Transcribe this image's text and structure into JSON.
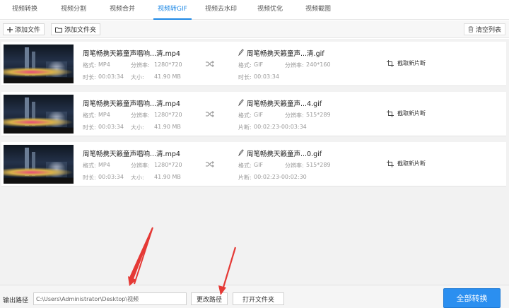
{
  "tabs": [
    {
      "label": "视频转换",
      "active": false
    },
    {
      "label": "视频分割",
      "active": false
    },
    {
      "label": "视频合并",
      "active": false
    },
    {
      "label": "视频转GIF",
      "active": true
    },
    {
      "label": "视频去水印",
      "active": false
    },
    {
      "label": "视频优化",
      "active": false
    },
    {
      "label": "视频截图",
      "active": false
    }
  ],
  "toolbar": {
    "add_file": "添加文件",
    "add_folder": "添加文件夹",
    "clear_list": "清空列表"
  },
  "labels": {
    "format": "格式:",
    "resolution": "分辨率:",
    "duration": "时长:",
    "size": "大小:",
    "segment": "片断:",
    "clip_new": "截取新片断"
  },
  "files": [
    {
      "src_name": "周笔畅携天籁童声唱响...清.mp4",
      "src_format": "MP4",
      "src_resolution": "1280*720",
      "src_duration": "00:03:34",
      "src_size": "41.90 MB",
      "out_name": "周笔畅携天籁童声...清.gif",
      "out_format": "GIF",
      "out_resolution": "240*160",
      "out_time_label": "时长:",
      "out_time": "00:03:34"
    },
    {
      "src_name": "周笔畅携天籁童声唱响...清.mp4",
      "src_format": "MP4",
      "src_resolution": "1280*720",
      "src_duration": "00:03:34",
      "src_size": "41.90 MB",
      "out_name": "周笔畅携天籁童声...4.gif",
      "out_format": "GIF",
      "out_resolution": "515*289",
      "out_time_label": "片断:",
      "out_time": "00:02:23-00:03:34"
    },
    {
      "src_name": "周笔畅携天籁童声唱响...清.mp4",
      "src_format": "MP4",
      "src_resolution": "1280*720",
      "src_duration": "00:03:34",
      "src_size": "41.90 MB",
      "out_name": "周笔畅携天籁童声...0.gif",
      "out_format": "GIF",
      "out_resolution": "515*289",
      "out_time_label": "片断:",
      "out_time": "00:02:23-00:02:30"
    }
  ],
  "bottom": {
    "output_label": "输出路径",
    "output_path": "C:\\Users\\Administrator\\Desktop\\视频",
    "change_path": "更改路径",
    "open_folder": "打开文件夹",
    "convert_all": "全部转换"
  },
  "colors": {
    "accent": "#1e88e5",
    "convert_button": "#2b8ff0",
    "annotation_arrow": "#e53935"
  }
}
